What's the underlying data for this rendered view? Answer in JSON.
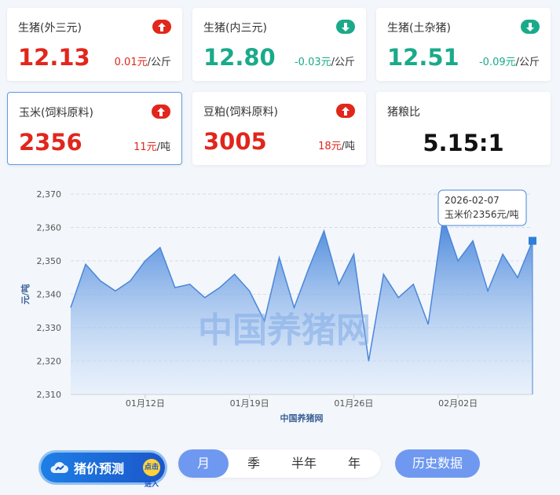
{
  "cards": [
    {
      "name": "生猪(外三元)",
      "price": "12.13",
      "change": "0.01元",
      "unit": "/公斤",
      "trend": "up"
    },
    {
      "name": "生猪(内三元)",
      "price": "12.80",
      "change": "-0.03元",
      "unit": "/公斤",
      "trend": "down"
    },
    {
      "name": "生猪(土杂猪)",
      "price": "12.51",
      "change": "-0.09元",
      "unit": "/公斤",
      "trend": "down"
    },
    {
      "name": "玉米(饲料原料)",
      "price": "2356",
      "change": "11元",
      "unit": "/吨",
      "trend": "up"
    },
    {
      "name": "豆粕(饲料原料)",
      "price": "3005",
      "change": "18元",
      "unit": "/吨",
      "trend": "up"
    },
    {
      "name": "猪粮比",
      "price": "5.15:1"
    }
  ],
  "colors": {
    "up": "#e1261c",
    "down": "#1aaa8a",
    "line": "#4a86d8",
    "accent": "#6f98f0"
  },
  "chart_data": {
    "type": "area",
    "ylabel": "元/吨",
    "xlabel": "中国养猪网",
    "watermark": "中国养猪网",
    "ylim": [
      2310,
      2370
    ],
    "yticks": [
      "2,310",
      "2,320",
      "2,330",
      "2,340",
      "2,350",
      "2,360",
      "2,370"
    ],
    "xticks": [
      {
        "label": "01月12日",
        "x": "2026-01-12"
      },
      {
        "label": "01月19日",
        "x": "2026-01-19"
      },
      {
        "label": "01月26日",
        "x": "2026-01-26"
      },
      {
        "label": "02月02日",
        "x": "2026-02-02"
      }
    ],
    "grid": true,
    "series": [
      {
        "x": [
          "2026-01-07",
          "2026-01-08",
          "2026-01-09",
          "2026-01-10",
          "2026-01-11",
          "2026-01-12",
          "2026-01-13",
          "2026-01-14",
          "2026-01-15",
          "2026-01-16",
          "2026-01-17",
          "2026-01-18",
          "2026-01-19",
          "2026-01-20",
          "2026-01-21",
          "2026-01-22",
          "2026-01-23",
          "2026-01-24",
          "2026-01-25",
          "2026-01-26",
          "2026-01-27",
          "2026-01-28",
          "2026-01-29",
          "2026-01-30",
          "2026-01-31",
          "2026-02-01",
          "2026-02-02",
          "2026-02-03",
          "2026-02-04",
          "2026-02-05",
          "2026-02-06",
          "2026-02-07"
        ],
        "values": [
          2336,
          2349,
          2344,
          2341,
          2344,
          2350,
          2354,
          2342,
          2343,
          2339,
          2342,
          2346,
          2341,
          2332,
          2351,
          2336,
          2348,
          2359,
          2343,
          2352,
          2320,
          2346,
          2339,
          2343,
          2331,
          2363,
          2350,
          2356,
          2341,
          2352,
          2345,
          2356
        ]
      }
    ],
    "tooltip": {
      "date": "2026-02-07",
      "text": "玉米价2356元/吨"
    }
  },
  "controls": {
    "forecast_label": "猪价预测",
    "forecast_go": "点击进入",
    "tabs": [
      "月",
      "季",
      "半年",
      "年"
    ],
    "active_tab": "月",
    "history_label": "历史数据"
  }
}
